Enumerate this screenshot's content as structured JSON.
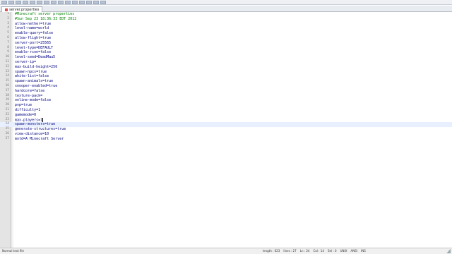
{
  "tab": {
    "label": "server.properties"
  },
  "editor": {
    "current_line": 24,
    "lines": [
      {
        "n": "1",
        "text": "#Minecraft server properties",
        "type": "comment"
      },
      {
        "n": "2",
        "text": "#Sun Sep 23 18:36:33 EDT 2012",
        "type": "comment"
      },
      {
        "n": "3",
        "text": "allow-nether=true",
        "type": "text"
      },
      {
        "n": "4",
        "text": "level-name=world",
        "type": "text"
      },
      {
        "n": "5",
        "text": "enable-query=false",
        "type": "text"
      },
      {
        "n": "6",
        "text": "allow-flight=true",
        "type": "text"
      },
      {
        "n": "7",
        "text": "server-port=25565",
        "type": "text"
      },
      {
        "n": "8",
        "text": "level-type=DEFAULT",
        "type": "text"
      },
      {
        "n": "9",
        "text": "enable-rcon=false",
        "type": "text"
      },
      {
        "n": "10",
        "text": "level-seed=DeadMau5",
        "type": "text"
      },
      {
        "n": "11",
        "text": "server-ip=",
        "type": "text"
      },
      {
        "n": "12",
        "text": "max-build-height=256",
        "type": "text"
      },
      {
        "n": "13",
        "text": "spawn-npcs=true",
        "type": "text"
      },
      {
        "n": "14",
        "text": "white-list=false",
        "type": "text"
      },
      {
        "n": "15",
        "text": "spawn-animals=true",
        "type": "text"
      },
      {
        "n": "16",
        "text": "snooper-enabled=true",
        "type": "text"
      },
      {
        "n": "17",
        "text": "hardcore=false",
        "type": "text"
      },
      {
        "n": "18",
        "text": "texture-pack=",
        "type": "text"
      },
      {
        "n": "19",
        "text": "online-mode=false",
        "type": "text"
      },
      {
        "n": "20",
        "text": "pvp=true",
        "type": "text"
      },
      {
        "n": "21",
        "text": "difficulty=1",
        "type": "text"
      },
      {
        "n": "22",
        "text": "gamemode=0",
        "type": "text"
      },
      {
        "n": "23",
        "text": "max-players=1",
        "type": "text"
      },
      {
        "n": "24",
        "text": "spawn-monsters=true",
        "type": "text"
      },
      {
        "n": "25",
        "text": "generate-structures=true",
        "type": "text"
      },
      {
        "n": "26",
        "text": "view-distance=10",
        "type": "text"
      },
      {
        "n": "27",
        "text": "motd=A Minecraft Server",
        "type": "text"
      }
    ]
  },
  "statusbar": {
    "left": "Normal text file",
    "right": "length : 623    lines : 27    Ln : 24    Col : 14    Sel : 0    UNIX    ANSI    INS"
  },
  "colors": {
    "text": "#000080",
    "comment": "#008000",
    "gutter": "#e4e4e4"
  }
}
